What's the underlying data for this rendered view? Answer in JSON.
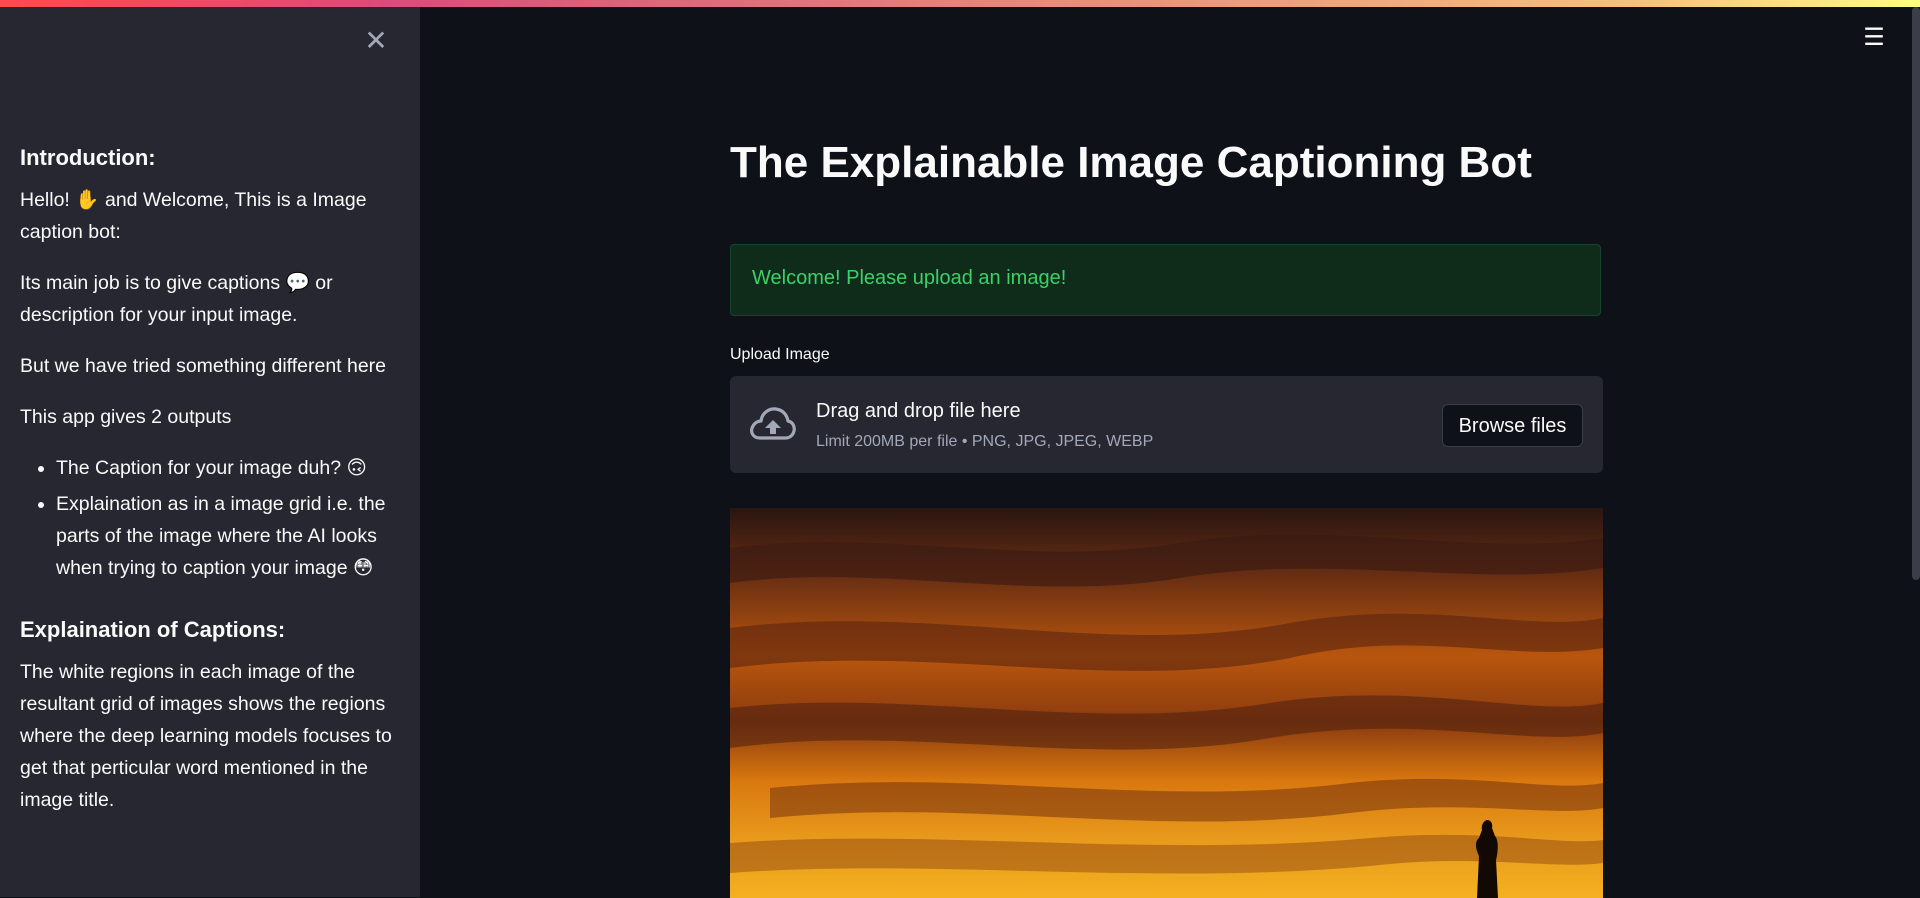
{
  "sidebar": {
    "close_symbol": "✕",
    "intro_heading": "Introduction:",
    "intro_p1": "Hello! ✋ and Welcome, This is a Image caption bot:",
    "intro_p2": "Its main job is to give captions 💬 or description for your input image.",
    "intro_p3": "But we have tried something different here",
    "intro_p4": "This app gives 2 outputs",
    "outputs": [
      "The Caption for your image duh? 🙃",
      "Explaination as in a image grid i.e. the parts of the image where the AI looks when trying to caption your image 😳"
    ],
    "expl_heading": "Explaination of Captions:",
    "expl_p1": "The white regions in each image of the resultant grid of images shows the regions where the deep learning models focuses to get that perticular word mentioned in the image title."
  },
  "header": {
    "menu_symbol": "☰"
  },
  "main": {
    "title": "The Explainable Image Captioning Bot",
    "alert_text": "Welcome! Please upload an image!",
    "upload_label": "Upload Image",
    "dropzone_title": "Drag and drop file here",
    "dropzone_subtitle": "Limit 200MB per file • PNG, JPG, JPEG, WEBP",
    "browse_label": "Browse files",
    "icons": {
      "upload": "cloud-upload-icon",
      "close": "close-icon",
      "menu": "hamburger-menu-icon"
    }
  },
  "colors": {
    "background": "#0e1117",
    "sidebar": "#262730",
    "alert_bg": "#0f2c1b",
    "alert_text": "#3cd067",
    "dropzone": "#262730"
  }
}
